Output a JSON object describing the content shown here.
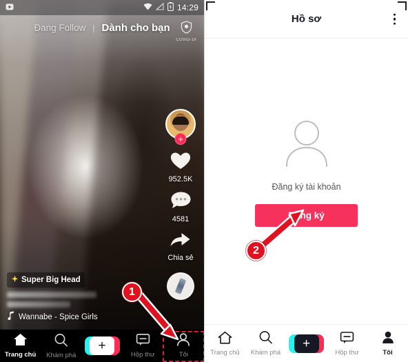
{
  "left_phone": {
    "status_bar": {
      "time": "14:29",
      "icons": [
        "cast-icon",
        "wifi-icon",
        "signal-icon",
        "battery-icon"
      ]
    },
    "top_tabs": {
      "following": "Đang Follow",
      "separator": "|",
      "for_you": "Dành cho bạn",
      "covid_label": "COVID-19",
      "covid_icon": "shield-icon"
    },
    "action_rail": {
      "avatar_icon": "user-avatar",
      "follow_badge": "+",
      "like_icon": "heart-icon",
      "like_count": "952.5K",
      "comment_icon": "comment-icon",
      "comment_count": "4581",
      "share_icon": "share-arrow-icon",
      "share_label": "Chia sẻ",
      "music_disc_icon": "music-disc-icon"
    },
    "caption": {
      "effect_icon": "sparkle-icon",
      "effect_label": "Super Big Head",
      "music_icon": "music-note-icon",
      "music_text": "Wannabe  - Spice Girls"
    },
    "bottom_nav": {
      "items": [
        {
          "label": "Trang chủ",
          "icon": "home-icon",
          "active": true
        },
        {
          "label": "Khám phá",
          "icon": "search-icon",
          "active": false
        },
        {
          "label": "",
          "icon": "plus-create-icon",
          "active": false
        },
        {
          "label": "Hộp thư",
          "icon": "inbox-icon",
          "active": false
        },
        {
          "label": "Tôi",
          "icon": "person-icon",
          "active": false
        }
      ],
      "create_symbol": "+"
    }
  },
  "right_phone": {
    "header": {
      "title": "Hồ sơ",
      "menu_icon": "kebab-menu-icon"
    },
    "body": {
      "avatar_placeholder_icon": "person-outline-icon",
      "signup_prompt": "Đăng ký tài khoản",
      "signup_button": "Đăng ký"
    },
    "bottom_nav": {
      "items": [
        {
          "label": "Trang chủ",
          "icon": "home-icon",
          "active": false
        },
        {
          "label": "Khám phá",
          "icon": "search-icon",
          "active": false
        },
        {
          "label": "",
          "icon": "plus-create-icon",
          "active": false
        },
        {
          "label": "Hộp thư",
          "icon": "inbox-icon",
          "active": false
        },
        {
          "label": "Tôi",
          "icon": "person-icon",
          "active": true
        }
      ],
      "create_symbol": "+"
    }
  },
  "annotations": {
    "colors": {
      "marker": "#e1121f",
      "accent": "#fe2c55",
      "button": "#f6315b"
    },
    "steps": [
      {
        "number": "1",
        "target": "Tôi tab in bottom navigation"
      },
      {
        "number": "2",
        "target": "Đăng ký button"
      }
    ]
  }
}
